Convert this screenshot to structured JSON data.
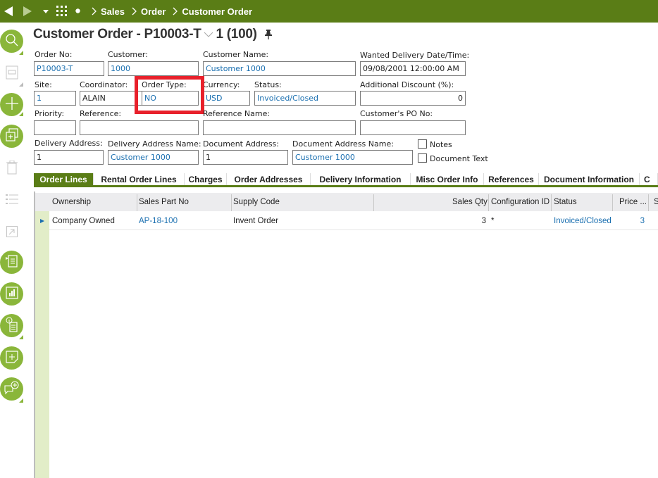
{
  "topbar": {
    "breadcrumb": [
      "Sales",
      "Order",
      "Customer Order"
    ],
    "icons": [
      "back-arrow-icon",
      "forward-arrow-icon",
      "dropdown-caret-icon",
      "apps-grid-icon",
      "dot-icon"
    ],
    "bg_color": "#5a7d16"
  },
  "sidebar": {
    "items": [
      "search",
      "save",
      "new",
      "duplicate",
      "delete",
      "list-view",
      "navigate",
      "details",
      "analytics",
      "info-list",
      "add-note",
      "add-comment"
    ],
    "accent_color": "#8ab63a"
  },
  "header": {
    "title": "Customer Order - P10003-T",
    "suffix": "1 (100)"
  },
  "form": {
    "order_no": {
      "label": "Order No:",
      "value": "P10003-T"
    },
    "customer": {
      "label": "Customer:",
      "value": "1000"
    },
    "customer_name": {
      "label": "Customer Name:",
      "value": "Customer 1000"
    },
    "wanted_delivery": {
      "label": "Wanted Delivery Date/Time:",
      "value": "09/08/2001 12:00:00 AM"
    },
    "site": {
      "label": "Site:",
      "value": "1"
    },
    "coordinator": {
      "label": "Coordinator:",
      "value": "ALAIN"
    },
    "order_type": {
      "label": "Order Type:",
      "value": "NO"
    },
    "currency": {
      "label": "Currency:",
      "value": "USD"
    },
    "status": {
      "label": "Status:",
      "value": "Invoiced/Closed"
    },
    "additional_discount": {
      "label": "Additional Discount (%):",
      "value": "0"
    },
    "priority": {
      "label": "Priority:",
      "value": ""
    },
    "reference": {
      "label": "Reference:",
      "value": ""
    },
    "reference_name": {
      "label": "Reference Name:",
      "value": ""
    },
    "customer_po": {
      "label": "Customer's PO No:",
      "value": ""
    },
    "delivery_address": {
      "label": "Delivery Address:",
      "value": "1"
    },
    "delivery_address_name": {
      "label": "Delivery Address Name:",
      "value": "Customer 1000"
    },
    "document_address": {
      "label": "Document Address:",
      "value": "1"
    },
    "document_address_name": {
      "label": "Document Address Name:",
      "value": "Customer 1000"
    },
    "notes": {
      "label": "Notes",
      "checked": false
    },
    "document_text": {
      "label": "Document Text",
      "checked": false
    }
  },
  "highlight": {
    "target": "order_type",
    "color": "#e8202b"
  },
  "tabs": [
    {
      "label": "Order Lines",
      "active": true
    },
    {
      "label": "Rental Order Lines",
      "active": false
    },
    {
      "label": "Charges",
      "active": false
    },
    {
      "label": "Order Addresses",
      "active": false
    },
    {
      "label": "Delivery Information",
      "active": false
    },
    {
      "label": "Misc Order Info",
      "active": false
    },
    {
      "label": "References",
      "active": false
    },
    {
      "label": "Document Information",
      "active": false
    },
    {
      "label": "C",
      "active": false
    }
  ],
  "grid": {
    "columns": [
      "Ownership",
      "Sales Part No",
      "Supply Code",
      "Sales Qty",
      "Configuration ID",
      "Status",
      "Price ...",
      "S"
    ],
    "rows": [
      [
        "Company Owned",
        "AP-18-100",
        "Invent Order",
        "3",
        "*",
        "Invoiced/Closed",
        "3",
        ""
      ]
    ]
  }
}
